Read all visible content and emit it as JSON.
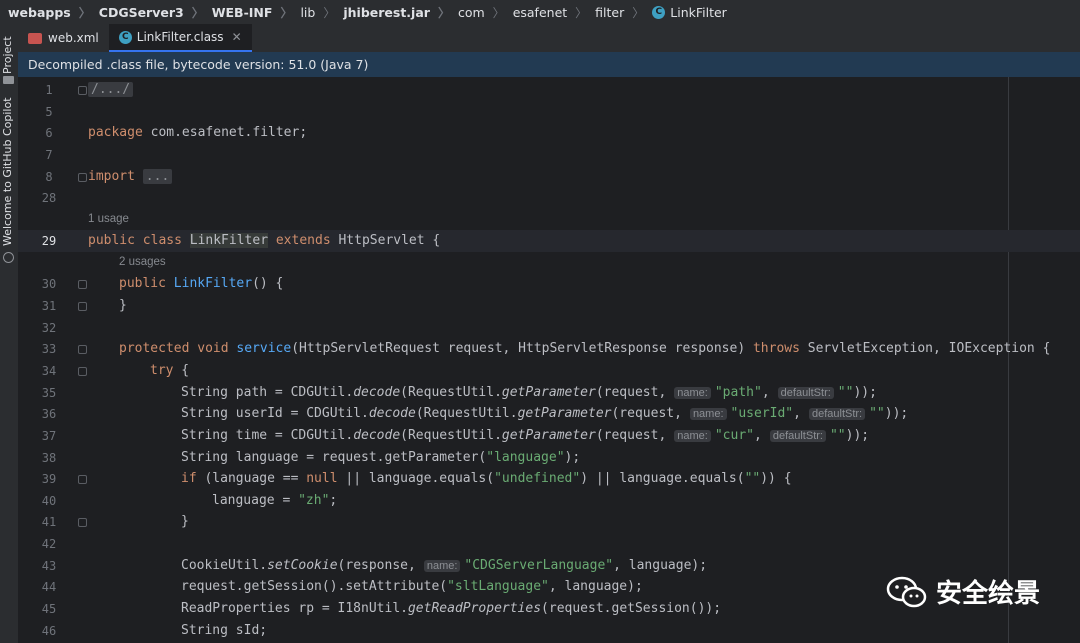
{
  "breadcrumb": [
    "webapps",
    "CDGServer3",
    "WEB-INF",
    "lib",
    "jhiberest.jar",
    "com",
    "esafenet",
    "filter",
    "LinkFilter"
  ],
  "side_panels": [
    "Project",
    "Welcome to GitHub Copilot"
  ],
  "tabs": [
    {
      "label": "web.xml",
      "active": false
    },
    {
      "label": "LinkFilter.class",
      "active": true
    }
  ],
  "banner": "Decompiled .class file, bytecode version: 51.0 (Java 7)",
  "line_numbers": [
    "1",
    "5",
    "6",
    "7",
    "8",
    "28",
    "29",
    "30",
    "31",
    "32",
    "33",
    "34",
    "35",
    "36",
    "37",
    "38",
    "39",
    "40",
    "41",
    "42",
    "43",
    "44",
    "45",
    "46"
  ],
  "usage_hints": [
    "1 usage",
    "2 usages"
  ],
  "code": {
    "l1": "/.../",
    "package_kw": "package",
    "package_name": " com.esafenet.filter;",
    "import_kw": "import",
    "import_fold": "...",
    "class_public": "public class ",
    "class_name": "LinkFilter",
    "class_extends": " extends ",
    "class_super": "HttpServlet {",
    "ctor_public": "public ",
    "ctor_name": "LinkFilter",
    "ctor_rest": "() {",
    "brace": "}",
    "svc_prot": "protected void ",
    "svc_name": "service",
    "svc_args": "(HttpServletRequest request, HttpServletResponse response) ",
    "svc_throws": "throws",
    "svc_exc": " ServletException, IOException {",
    "try": "try",
    "try_rest": " {",
    "l35a": "String path = CDGUtil.",
    "l35b": "decode",
    "l35c": "(RequestUtil.",
    "l35d": "getParameter",
    "l35e": "(request,",
    "h_name": "name:",
    "l35s": "\"path\"",
    "l35f": ",",
    "h_def": "defaultStr:",
    "l35g": "\"\"",
    "l35h": "));",
    "l36a": "String userId = CDGUtil.",
    "l36s": "\"userId\"",
    "l37a": "String time = CDGUtil.",
    "l37s": "\"cur\"",
    "l38a": "String language = request.getParameter(",
    "l38s": "\"language\"",
    "l38b": ");",
    "l39a": "if",
    "l39b": " (language == ",
    "l39null": "null",
    "l39c": " || language.equals(",
    "l39s1": "\"undefined\"",
    "l39d": ") || language.equals(",
    "l39s2": "\"\"",
    "l39e": ")) {",
    "l40a": "language = ",
    "l40s": "\"zh\"",
    "l40b": ";",
    "l43a": "CookieUtil.",
    "l43b": "setCookie",
    "l43c": "(response,",
    "l43s": "\"CDGServerLanguage\"",
    "l43d": ", language);",
    "l44a": "request.getSession().setAttribute(",
    "l44s": "\"sltLanguage\"",
    "l44b": ", language);",
    "l45a": "ReadProperties rp = I18nUtil.",
    "l45b": "getReadProperties",
    "l45c": "(request.getSession());",
    "l46": "String sId;"
  },
  "watermark": "安全绘景"
}
